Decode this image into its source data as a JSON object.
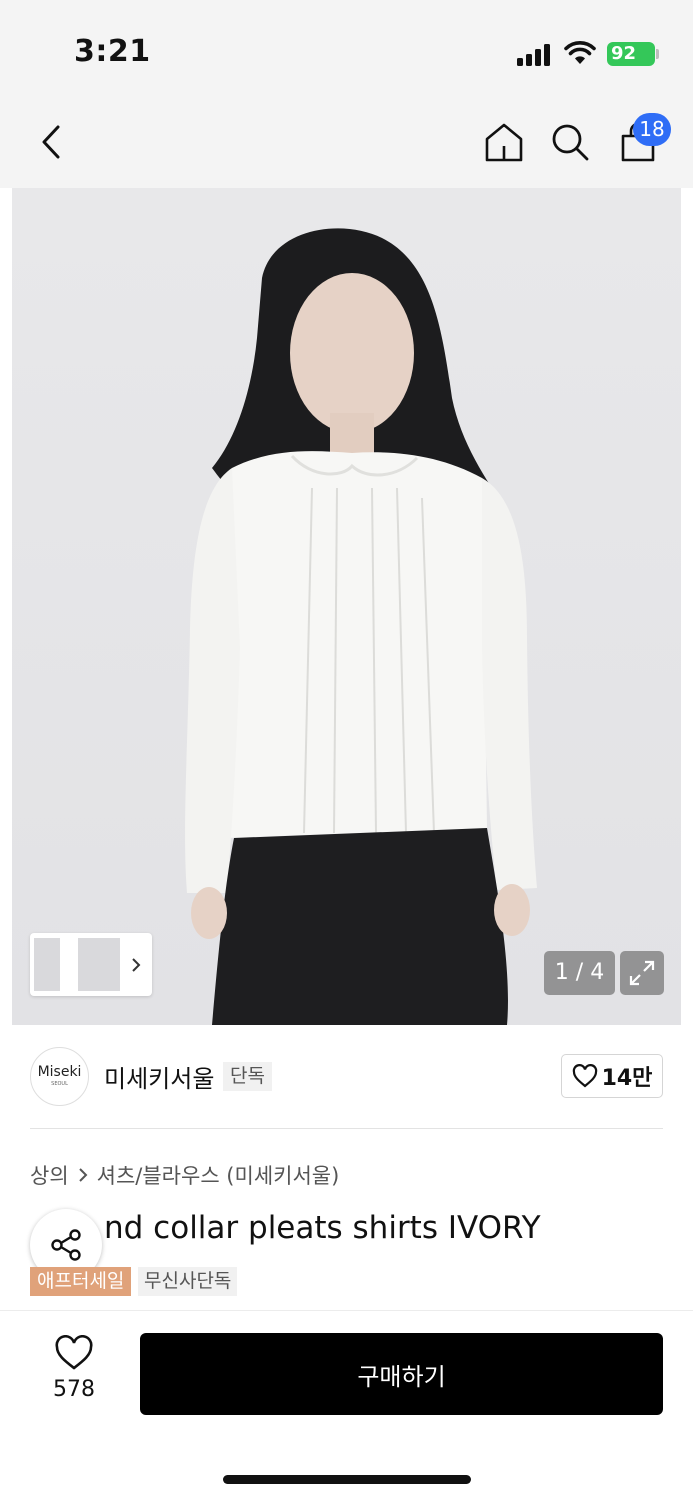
{
  "status_bar": {
    "time": "3:21",
    "battery": "92"
  },
  "nav": {
    "back_icon": "chevron-left-icon",
    "home_icon": "home-icon",
    "search_icon": "search-icon",
    "cart_icon": "shopping-bag-icon",
    "cart_count": "18"
  },
  "gallery": {
    "counter": "1 / 4"
  },
  "brand": {
    "logo_line1": "Miseki",
    "logo_line2": "SEOUL",
    "name": "미세키서울",
    "tag": "단독",
    "likes": "14만"
  },
  "breadcrumb": {
    "category": "상의",
    "subcategory": "셔츠/블라우스 (미세키서울)"
  },
  "product": {
    "title": "nd collar pleats shirts IVORY",
    "sale_tag": "애프터세일",
    "exclusive_tag": "무신사단독"
  },
  "bottom": {
    "wish_count": "578",
    "buy_label": "구매하기"
  },
  "colors": {
    "accent": "#2f6df6",
    "sale_tag": "#e0a27a",
    "buy_button": "#000000"
  }
}
